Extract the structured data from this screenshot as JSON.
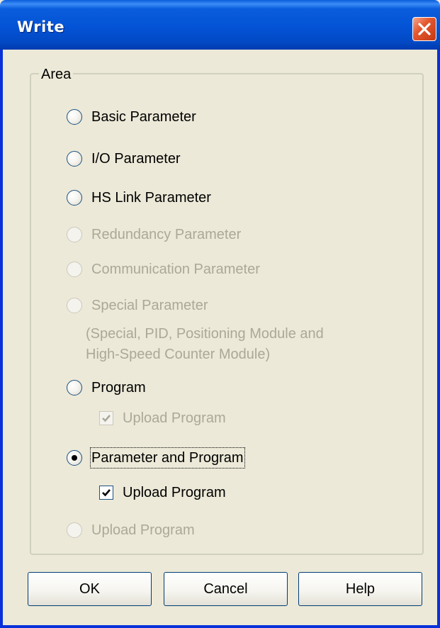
{
  "window": {
    "title": "Write"
  },
  "group": {
    "label": "Area"
  },
  "radios": [
    {
      "label": "Basic Parameter",
      "checked": false,
      "disabled": false
    },
    {
      "label": "I/O Parameter",
      "checked": false,
      "disabled": false
    },
    {
      "label": "HS Link Parameter",
      "checked": false,
      "disabled": false
    },
    {
      "label": "Redundancy Parameter",
      "checked": false,
      "disabled": true
    },
    {
      "label": "Communication Parameter",
      "checked": false,
      "disabled": true
    },
    {
      "label": "Special Parameter",
      "checked": false,
      "disabled": true
    },
    {
      "label": "Program",
      "checked": false,
      "disabled": false
    },
    {
      "label": "Parameter and Program",
      "checked": true,
      "disabled": false
    },
    {
      "label": "Upload Program",
      "checked": false,
      "disabled": true
    }
  ],
  "special_note": {
    "line1": "(Special, PID, Positioning Module and",
    "line2": "High-Speed Counter Module)"
  },
  "checkboxes": [
    {
      "label": "Upload Program",
      "checked": true,
      "disabled": true
    },
    {
      "label": "Upload Program",
      "checked": true,
      "disabled": false
    }
  ],
  "buttons": {
    "ok": "OK",
    "cancel": "Cancel",
    "help": "Help"
  }
}
